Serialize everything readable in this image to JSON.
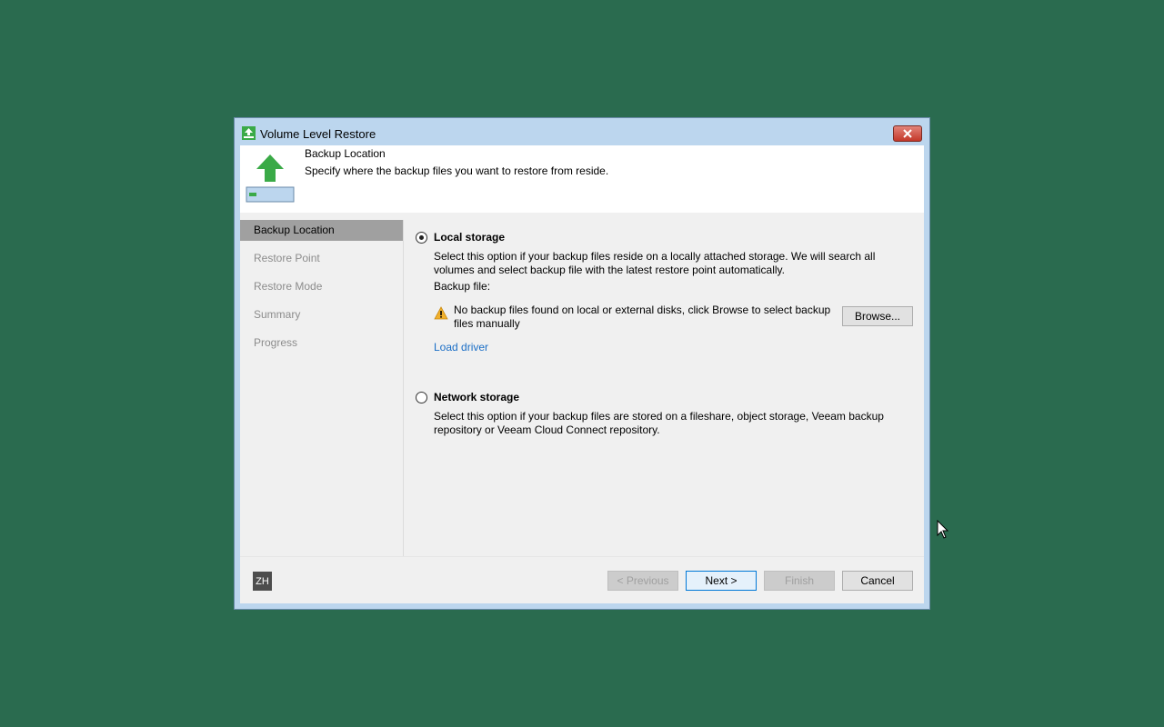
{
  "window": {
    "title": "Volume Level Restore",
    "close_icon": "close-icon"
  },
  "header": {
    "title": "Backup Location",
    "subtitle": "Specify where the backup files you want to restore from reside."
  },
  "nav": {
    "items": [
      {
        "label": "Backup Location",
        "active": true
      },
      {
        "label": "Restore Point",
        "active": false
      },
      {
        "label": "Restore Mode",
        "active": false
      },
      {
        "label": "Summary",
        "active": false
      },
      {
        "label": "Progress",
        "active": false
      }
    ]
  },
  "local": {
    "label": "Local storage",
    "checked": true,
    "description": "Select this option if your backup files reside on a locally attached storage. We will search all volumes and select backup file with the latest restore point automatically.",
    "backup_file_label": "Backup file:",
    "warning": "No backup files found on local or external disks, click Browse to select backup files manually",
    "browse_label": "Browse...",
    "load_driver_label": "Load driver"
  },
  "network": {
    "label": "Network storage",
    "checked": false,
    "description": "Select this option if your backup files are stored on a fileshare, object storage, Veeam backup repository or Veeam Cloud Connect repository."
  },
  "footer": {
    "lang": "ZH",
    "previous_label": "< Previous",
    "next_label": "Next >",
    "finish_label": "Finish",
    "cancel_label": "Cancel"
  },
  "colors": {
    "desktop": "#2a6b4f",
    "accent_green": "#3aaa47",
    "link": "#1a6ec6"
  }
}
